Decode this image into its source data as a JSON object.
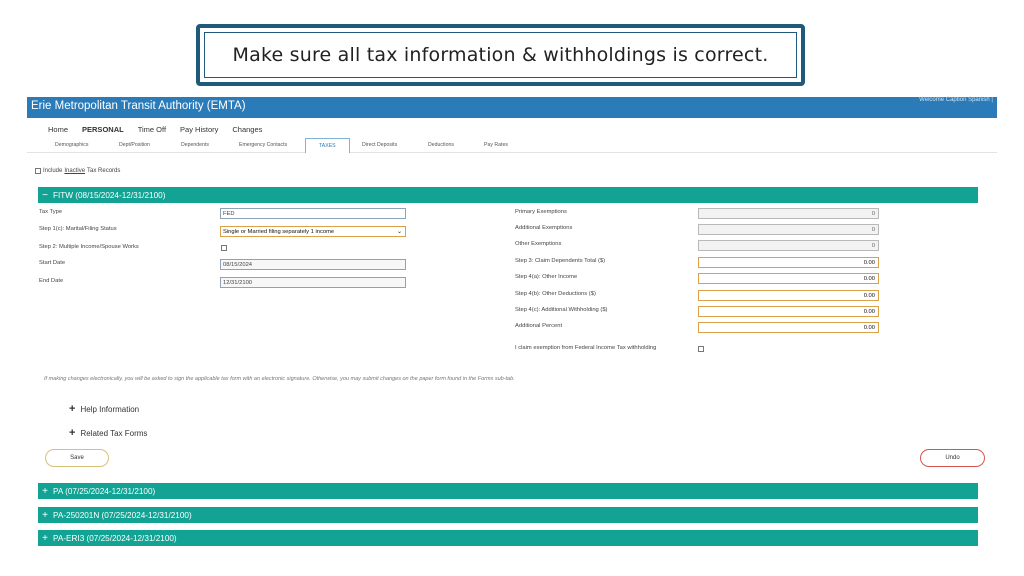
{
  "banner": {
    "text": "Make sure all tax information & withholdings is correct."
  },
  "app": {
    "title": "Erie Metropolitan Transit Authority (EMTA)",
    "welcome": "Welcome Caption Spanish |"
  },
  "main_nav": [
    {
      "label": "Home",
      "active": false
    },
    {
      "label": "PERSONAL",
      "active": true
    },
    {
      "label": "Time Off",
      "active": false
    },
    {
      "label": "Pay History",
      "active": false
    },
    {
      "label": "Changes",
      "active": false
    }
  ],
  "sub_nav": [
    {
      "label": "Demographics"
    },
    {
      "label": "Dept/Position"
    },
    {
      "label": "Dependents"
    },
    {
      "label": "Emergency Contacts"
    },
    {
      "label": "TAXES"
    },
    {
      "label": "Direct Deposits"
    },
    {
      "label": "Deductions"
    },
    {
      "label": "Pay Rates"
    }
  ],
  "inactive": {
    "prefix": "Include ",
    "underlined": "Inactive",
    "suffix": " Tax Records",
    "checked": false
  },
  "fitw": {
    "symbol": "−",
    "title": "FITW (08/15/2024-12/31/2100)",
    "left_fields": {
      "tax_type_label": "Tax Type",
      "tax_type_value": "FED",
      "marital_label": "Step 1(c): Marital/Filing Status",
      "marital_value": "Single or Married filing separately 1 income",
      "multiple_label": "Step 2: Multiple Income/Spouse Works",
      "start_label": "Start Date",
      "start_value": "08/15/2024",
      "end_label": "End Date",
      "end_value": "12/31/2100"
    },
    "right_fields": [
      {
        "label": "Primary Exemptions",
        "value": "0",
        "readonly": true
      },
      {
        "label": "Additional Exemptions",
        "value": "0",
        "readonly": true
      },
      {
        "label": "Other Exemptions",
        "value": "0",
        "readonly": true
      },
      {
        "label": "Step 3: Claim Dependents Total ($)",
        "value": "0.00",
        "readonly": false
      },
      {
        "label": "Step 4(a): Other Income",
        "value": "0.00",
        "readonly": false
      },
      {
        "label": "Step 4(b): Other Deductions ($)",
        "value": "0.00",
        "readonly": false
      },
      {
        "label": "Step 4(c): Additional Withholding ($)",
        "value": "0.00",
        "readonly": false
      },
      {
        "label": "Additional Percent",
        "value": "0.00",
        "readonly": false
      }
    ],
    "exemption_label": "I claim exemption from Federal Income Tax withholding"
  },
  "note": "If making changes electronically, you will be asked to sign the applicable tax form with an electronic signature. Otherwise, you may submit changes on the paper form found in the Forms sub-tab.",
  "expanders": [
    {
      "symbol": "+",
      "label": "Help Information"
    },
    {
      "symbol": "+",
      "label": "Related Tax Forms"
    }
  ],
  "buttons": {
    "save": "Save",
    "undo": "Undo"
  },
  "sections": [
    {
      "symbol": "+",
      "title": "PA (07/25/2024-12/31/2100)"
    },
    {
      "symbol": "+",
      "title": "PA-250201N (07/25/2024-12/31/2100)"
    },
    {
      "symbol": "+",
      "title": "PA-ERI3 (07/25/2024-12/31/2100)"
    }
  ],
  "colors": {
    "header": "#2b7bb9",
    "section": "#12a394",
    "banner_border": "#1f5a7a"
  }
}
